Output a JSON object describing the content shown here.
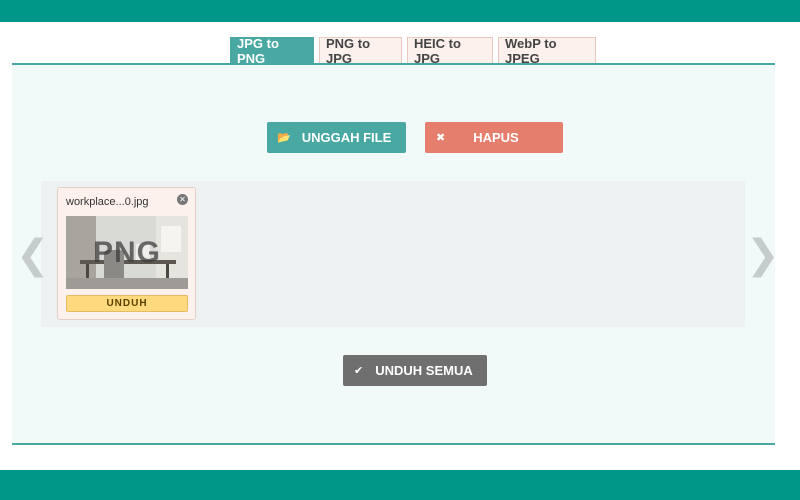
{
  "tabs": [
    {
      "label": "JPG to PNG",
      "active": true
    },
    {
      "label": "PNG to JPG",
      "active": false
    },
    {
      "label": "HEIC to JPG",
      "active": false
    },
    {
      "label": "WebP to JPEG",
      "active": false
    }
  ],
  "actions": {
    "upload_label": "UNGGAH FILE",
    "clear_label": "HAPUS",
    "download_all_label": "UNDUH SEMUA"
  },
  "carousel": {
    "prev_glyph": "❮",
    "next_glyph": "❯"
  },
  "files": [
    {
      "name": "workplace...0.jpg",
      "format_label": "PNG",
      "download_label": "UNDUH"
    }
  ],
  "colors": {
    "brand": "#009688",
    "accent": "#4aa8a2",
    "danger": "#e67e6d",
    "neutral": "#6f6f6f",
    "download": "#ffd97e"
  },
  "icons": {
    "upload": "folder-open-icon",
    "clear": "close-icon",
    "download_all": "check-icon",
    "remove_file": "close-circle-icon"
  }
}
